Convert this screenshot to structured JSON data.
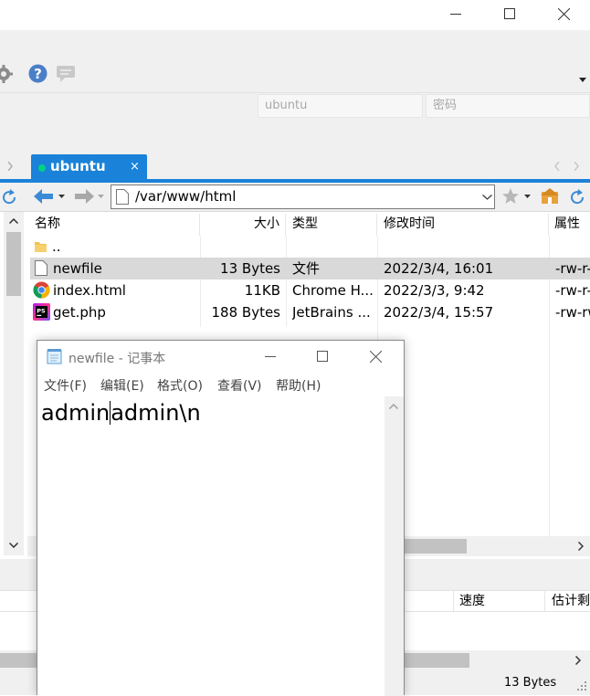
{
  "winscp": {
    "window_buttons": {
      "minimize": "minimize-icon",
      "maximize": "maximize-icon",
      "close": "close-icon"
    },
    "toolbar": {
      "icons": [
        "gear-icon",
        "help-icon",
        "feedback-icon"
      ]
    },
    "connection": {
      "username": "ubuntu",
      "password_placeholder": "密码"
    },
    "session_tab": {
      "label": "ubuntu",
      "close": "×",
      "status_color": "#00d084"
    },
    "accent_color": "#1a82d8",
    "path": "/var/www/html",
    "columns": [
      "名称",
      "大小",
      "类型",
      "修改时间",
      "属性"
    ],
    "files": [
      {
        "name": "..",
        "icon": "folder-up-icon",
        "size": "",
        "type": "",
        "modified": "",
        "attrs": ""
      },
      {
        "name": "newfile",
        "icon": "file-icon",
        "size": "13 Bytes",
        "type": "文件",
        "modified": "2022/3/4, 16:01",
        "attrs": "-rw-r--",
        "selected": true
      },
      {
        "name": "index.html",
        "icon": "chrome-icon",
        "size": "11KB",
        "type": "Chrome H...",
        "modified": "2022/3/3, 9:42",
        "attrs": "-rw-r--"
      },
      {
        "name": "get.php",
        "icon": "phpstorm-icon",
        "size": "188 Bytes",
        "type": "JetBrains ...",
        "modified": "2022/3/4, 15:57",
        "attrs": "-rw-rw-"
      }
    ],
    "queue_columns": {
      "speed": "速度",
      "eta": "估计剩余"
    },
    "status_size": "13 Bytes"
  },
  "notepad": {
    "title": "newfile - 记事本",
    "menu": [
      "文件(F)",
      "编辑(E)",
      "格式(O)",
      "查看(V)",
      "帮助(H)"
    ],
    "content_before_cursor": "admin",
    "content_after_cursor": "admin\\n"
  }
}
